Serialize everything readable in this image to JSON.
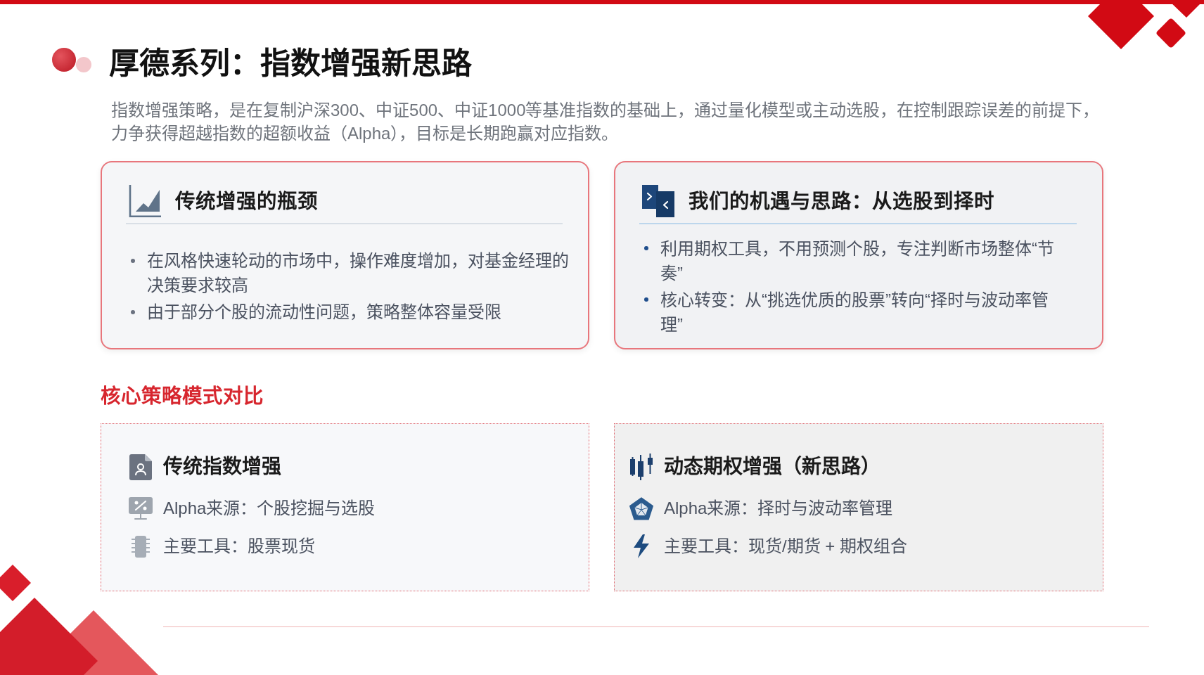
{
  "header": {
    "title": "厚德系列：指数增强新思路",
    "description": "指数增强策略，是在复制沪深300、中证500、中证1000等基准指数的基础上，通过量化模型或主动选股，在控制跟踪误差的前提下，力争获得超越指数的超额收益（Alpha），目标是长期跑赢对应指数。"
  },
  "cards": [
    {
      "kind": "traditional",
      "title": "传统增强的瓶颈",
      "bullets": [
        "在风格快速轮动的市场中，操作难度增加，对基金经理的决策要求较高",
        "由于部分个股的流动性问题，策略整体容量受限"
      ]
    },
    {
      "kind": "new",
      "title": "我们的机遇与思路：从选股到择时",
      "bullets": [
        "利用期权工具，不用预测个股，专注判断市场整体“节奏”",
        "核心转变：从“挑选优质的股票”转向“择时与波动率管理”"
      ]
    }
  ],
  "comparison": {
    "heading": "核心策略模式对比",
    "cards": [
      {
        "kind": "traditional",
        "title": "传统指数增强",
        "rows": [
          "Alpha来源：个股挖掘与选股",
          "主要工具：股票现货"
        ]
      },
      {
        "kind": "new",
        "title": "动态期权增强（新思路）",
        "rows": [
          "Alpha来源：择时与波动率管理",
          "主要工具：现货/期货 + 期权组合"
        ]
      }
    ]
  }
}
